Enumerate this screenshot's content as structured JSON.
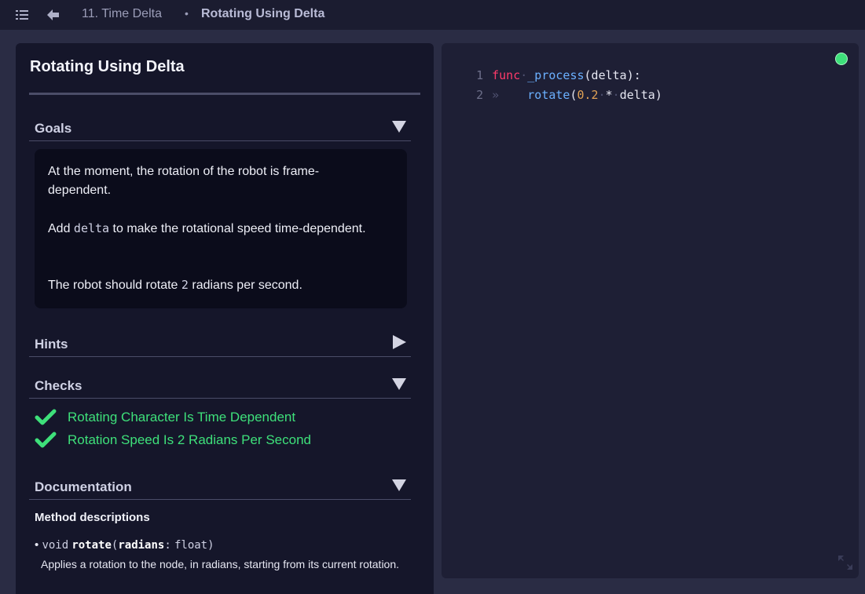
{
  "topbar": {
    "lesson": "11. Time Delta",
    "separator": "•",
    "current": "Rotating Using Delta",
    "menu_icon": "list-menu-icon",
    "back_icon": "arrow-left-icon"
  },
  "panel": {
    "title": "Rotating Using Delta",
    "goals": {
      "label": "Goals",
      "p1": "At the moment, the rotation of the robot is frame-dependent.",
      "p2_pre": "Add ",
      "p2_code": "delta",
      "p2_post": " to make the rotational speed time-dependent.",
      "p3_pre": "The robot should rotate ",
      "p3_code": "2",
      "p3_post": " radians per second."
    },
    "hints": {
      "label": "Hints"
    },
    "checks": {
      "label": "Checks",
      "items": [
        "Rotating Character Is Time Dependent",
        "Rotation Speed Is 2 Radians Per Second"
      ]
    },
    "docs": {
      "label": "Documentation",
      "heading": "Method descriptions",
      "bullet": "•",
      "sig_void": "void",
      "sig_name": "rotate",
      "sig_open": "(",
      "sig_arg": "radians",
      "sig_colon": ":",
      "sig_type": "float",
      "sig_close": ")",
      "description": "Applies a rotation to the node, in radians, starting from its current rotation."
    }
  },
  "editor": {
    "lines": [
      {
        "num": "1",
        "kw": "func",
        "ws": "·",
        "fn": "_process",
        "rest": "(delta):"
      },
      {
        "num": "2",
        "indent": "»",
        "fn": "rotate",
        "open": "(",
        "num_val": "0.2",
        "ws1": "·",
        "op": "*",
        "ws2": "·",
        "rest": "delta)"
      }
    ],
    "status": "ok",
    "status_color": "#3ee07a"
  },
  "colors": {
    "accent_green": "#3ee07a",
    "keyword": "#ff3a6a",
    "function": "#6bb0ff",
    "number": "#e0a155"
  }
}
